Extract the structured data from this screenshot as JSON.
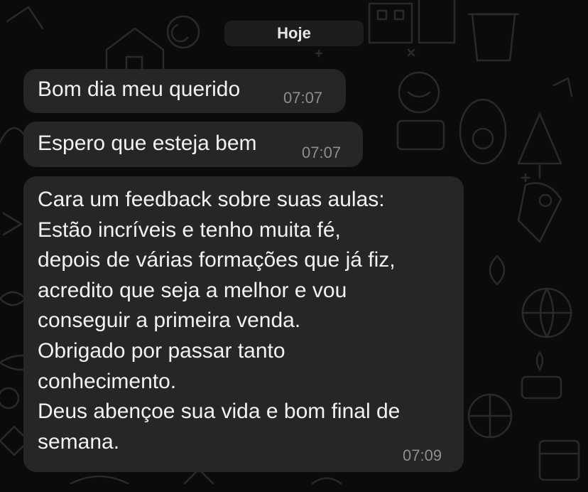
{
  "chat": {
    "date_label": "Hoje",
    "colors": {
      "background": "#0b0b0b",
      "bubble": "#262626",
      "text": "#f2f2f2",
      "timestamp": "#8e8e8e",
      "date_pill": "#1d1d1d"
    },
    "messages": [
      {
        "text": "Bom dia meu querido",
        "time": "07:07"
      },
      {
        "text": "Espero que esteja bem",
        "time": "07:07"
      },
      {
        "text": "Cara um feedback sobre suas aulas:\nEstão incríveis e tenho muita fé,\ndepois de várias formações que já fiz,\nacredito que seja a melhor e vou\nconseguir a primeira venda.\nObrigado por passar tanto\nconhecimento.\nDeus abençoe sua vida e bom final de\nsemana.",
        "time": "07:09"
      }
    ]
  }
}
